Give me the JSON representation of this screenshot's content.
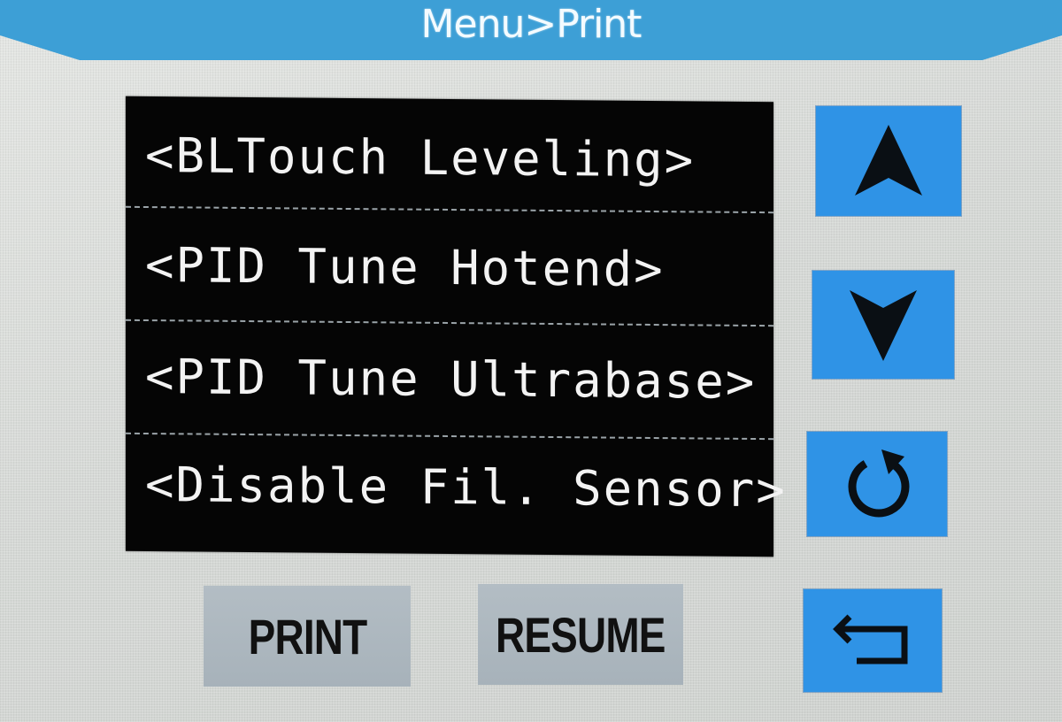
{
  "header": {
    "title": "Menu>Print"
  },
  "menu": {
    "items": [
      {
        "label": "<BLTouch Leveling>"
      },
      {
        "label": "<PID Tune Hotend>"
      },
      {
        "label": "<PID Tune Ultrabase>"
      },
      {
        "label": "<Disable Fil. Sensor>"
      }
    ]
  },
  "buttons": {
    "print_label": "PRINT",
    "resume_label": "RESUME"
  },
  "side_buttons": {
    "up_icon": "arrow-up-icon",
    "down_icon": "arrow-down-icon",
    "refresh_icon": "refresh-icon",
    "back_icon": "return-icon"
  },
  "colors": {
    "accent": "#2f93e6",
    "menu_background": "#050505",
    "menu_text": "#f3f3f3",
    "button_gray": "#aeb8bf"
  }
}
